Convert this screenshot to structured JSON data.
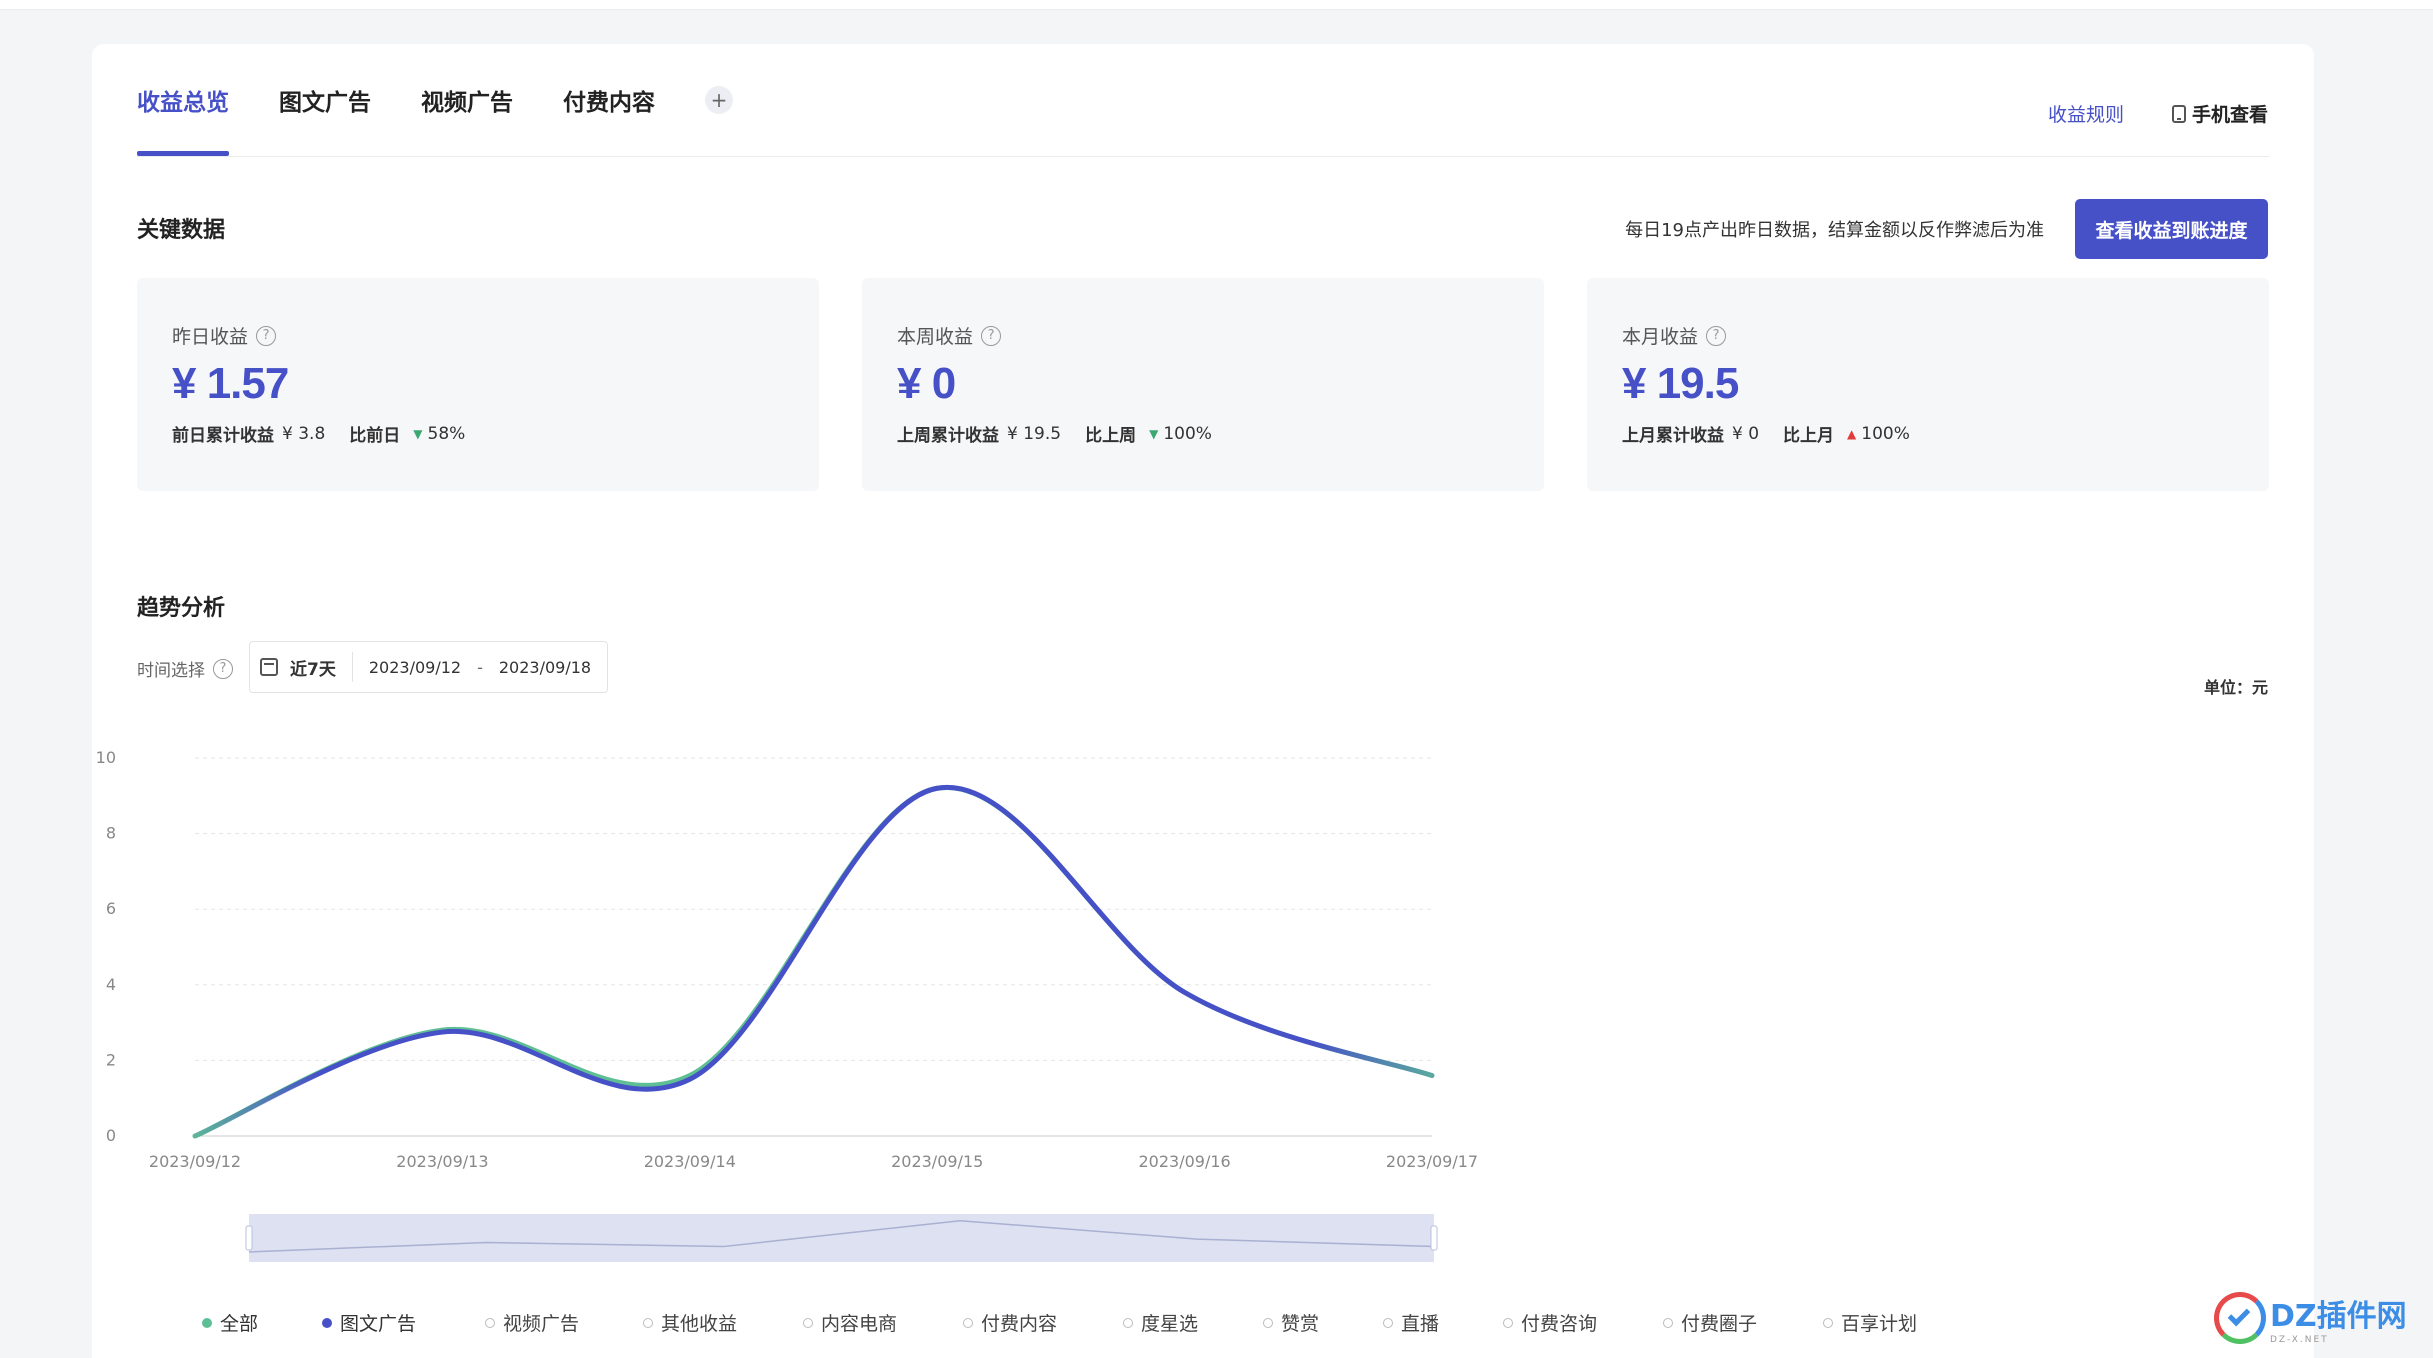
{
  "tabs": [
    {
      "label": "收益总览",
      "active": true
    },
    {
      "label": "图文广告",
      "active": false
    },
    {
      "label": "视频广告",
      "active": false
    },
    {
      "label": "付费内容",
      "active": false
    }
  ],
  "tab_add": "+",
  "header": {
    "rules_link": "收益规则",
    "mobile_view": "手机查看"
  },
  "key_data": {
    "title": "关键数据",
    "notice": "每日19点产出昨日数据，结算金额以反作弊滤后为准",
    "progress_button": "查看收益到账进度",
    "cards": [
      {
        "label": "昨日收益",
        "value": "¥ 1.57",
        "prev_label": "前日累计收益",
        "prev_value": "¥ 3.8",
        "cmp_label": "比前日",
        "trend": "down",
        "pct": "58%"
      },
      {
        "label": "本周收益",
        "value": "¥ 0",
        "prev_label": "上周累计收益",
        "prev_value": "¥ 19.5",
        "cmp_label": "比上周",
        "trend": "down",
        "pct": "100%"
      },
      {
        "label": "本月收益",
        "value": "¥ 19.5",
        "prev_label": "上月累计收益",
        "prev_value": "¥ 0",
        "cmp_label": "比上月",
        "trend": "up",
        "pct": "100%"
      }
    ]
  },
  "trend": {
    "title": "趋势分析",
    "time_label": "时间选择",
    "range_name": "近7天",
    "start_date": "2023/09/12",
    "end_date": "2023/09/18",
    "range_dash": "-",
    "unit": "单位：元"
  },
  "colors": {
    "accent": "#4650c7",
    "series_all": "#5fbf94",
    "series_graphic_ad": "#4650c7",
    "down": "#3ba872",
    "up": "#e23b3b"
  },
  "chart_data": {
    "type": "line",
    "x": [
      "2023/09/12",
      "2023/09/13",
      "2023/09/14",
      "2023/09/15",
      "2023/09/16",
      "2023/09/17"
    ],
    "ylim": [
      0,
      10
    ],
    "yticks": [
      0,
      2,
      4,
      6,
      8,
      10
    ],
    "grid": true,
    "smooth": true,
    "series": [
      {
        "name": "全部",
        "values": [
          0,
          2.8,
          1.6,
          9.2,
          3.8,
          1.6
        ]
      },
      {
        "name": "图文广告",
        "values": [
          0,
          2.75,
          1.5,
          9.2,
          3.8,
          1.6
        ]
      }
    ],
    "legend": [
      "全部",
      "图文广告",
      "视频广告",
      "其他收益",
      "内容电商",
      "付费内容",
      "度星选",
      "赞赏",
      "直播",
      "付费咨询",
      "付费圈子",
      "百享计划"
    ],
    "legend_active": [
      true,
      true,
      false,
      false,
      false,
      false,
      false,
      false,
      false,
      false,
      false,
      false
    ],
    "legend_placement": "bottom"
  },
  "watermark": {
    "title": "DZ插件网",
    "sub": "DZ-X.NET"
  }
}
